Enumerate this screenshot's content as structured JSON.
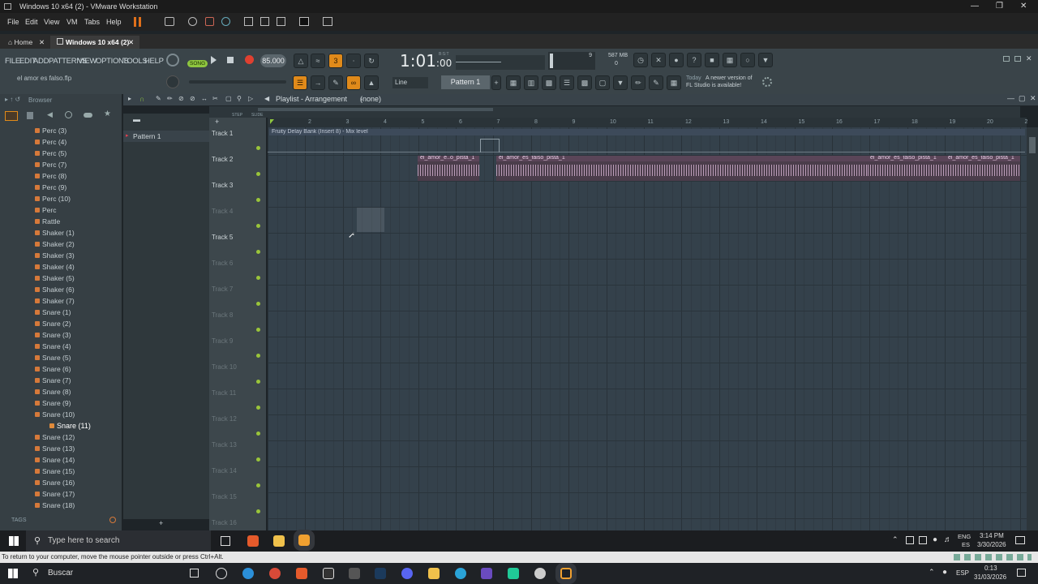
{
  "vm": {
    "title": "Windows 10 x64 (2) - VMware Workstation",
    "menu": [
      "File",
      "Edit",
      "View",
      "VM",
      "Tabs",
      "Help"
    ],
    "tabs": [
      {
        "label": "Home"
      },
      {
        "label": "Windows 10 x64 (2)"
      }
    ],
    "status_text": "To return to your computer, move the mouse pointer outside or press Ctrl+Alt."
  },
  "fl": {
    "menu": [
      "FILE",
      "EDIT",
      "ADD",
      "PATTERNS",
      "VIEW",
      "OPTIONS",
      "TOOLS",
      "HELP"
    ],
    "project_file": "el amor es falso.flp",
    "song_mode": "SONG",
    "tempo": "85.000",
    "time": "1:01",
    "time_sub": ":00",
    "time_unit": "B:S:T",
    "cpu_value": "9",
    "memory": "587 MB",
    "poly": "0",
    "snap": "Line",
    "pattern": "Pattern 1",
    "news_day": "Today",
    "news_text1": "A newer version of",
    "news_text2": "FL Studio is available!"
  },
  "browser": {
    "title": "Browser",
    "tags_label": "TAGS",
    "items": [
      "Perc (3)",
      "Perc (4)",
      "Perc (5)",
      "Perc (7)",
      "Perc (8)",
      "Perc (9)",
      "Perc (10)",
      "Perc",
      "Rattle",
      "Shaker (1)",
      "Shaker (2)",
      "Shaker (3)",
      "Shaker (4)",
      "Shaker (5)",
      "Shaker (6)",
      "Shaker (7)",
      "Snare (1)",
      "Snare (2)",
      "Snare (3)",
      "Snare (4)",
      "Snare (5)",
      "Snare (6)",
      "Snare (7)",
      "Snare (8)",
      "Snare (9)",
      "Snare (10)",
      "Snare (11)",
      "Snare (12)",
      "Snare (13)",
      "Snare (14)",
      "Snare (15)",
      "Snare (16)",
      "Snare (17)",
      "Snare (18)"
    ],
    "selected_index": 26
  },
  "playlist": {
    "title": "Playlist - Arrangement",
    "arrangement": "(none)",
    "step_label": "STEP",
    "slide_label": "SLIDE",
    "patterns": [
      "Pattern 1"
    ],
    "tracks": [
      "Track 1",
      "Track 2",
      "Track 3",
      "Track 4",
      "Track 5",
      "Track 6",
      "Track 7",
      "Track 8",
      "Track 9",
      "Track 10",
      "Track 11",
      "Track 12",
      "Track 13",
      "Track 14",
      "Track 15",
      "Track 16"
    ],
    "ruler": [
      "2",
      "3",
      "4",
      "5",
      "6",
      "7",
      "8",
      "9",
      "10",
      "11",
      "12",
      "13",
      "14",
      "15",
      "16",
      "17",
      "18",
      "19",
      "20",
      "2"
    ],
    "automation_clip": "Fruity Delay Bank (Insert 8) - Mix level",
    "audio_clips": [
      "el_amor_e..o_pista_1",
      "el_amor_es_falso_pista_1",
      "el_amor_es_falso_pista_1",
      "el_amor_es_falso_pista_1"
    ]
  },
  "guest_taskbar": {
    "search_placeholder": "Type here to search",
    "lang": "ENG",
    "lang_sub": "ES",
    "time": "3:14 PM",
    "date": "3/30/2026"
  },
  "host_taskbar": {
    "search_placeholder": "Buscar",
    "lang": "ESP",
    "time": "0:13",
    "date": "31/03/2026"
  }
}
